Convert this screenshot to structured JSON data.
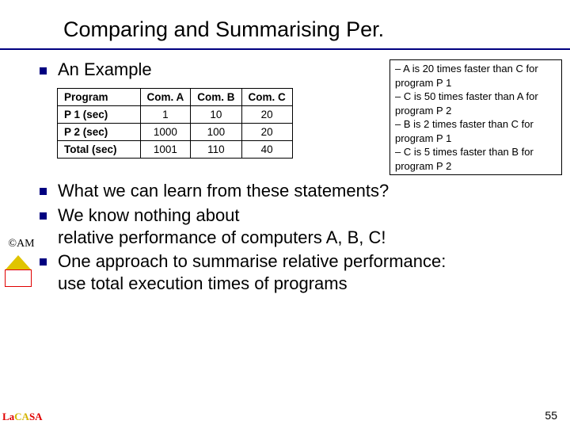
{
  "title": "Comparing and Summarising Per.",
  "heading": "An Example",
  "box": {
    "l1": "– A is 20 times faster than C for program P 1",
    "l2": "– C is 50 times faster than A for program P 2",
    "l3": "– B is 2 times faster than C for program P 1",
    "l4": "– C is 5 times faster than B for program P 2"
  },
  "table": {
    "h0": "Program",
    "h1": "Com. A",
    "h2": "Com. B",
    "h3": "Com. C",
    "r1": {
      "p": "P 1 (sec)",
      "a": "1",
      "b": "10",
      "c": "20"
    },
    "r2": {
      "p": "P 2 (sec)",
      "a": "1000",
      "b": "100",
      "c": "20"
    },
    "r3": {
      "p": "Total (sec)",
      "a": "1001",
      "b": "110",
      "c": "40"
    }
  },
  "bullets": {
    "b1": "What we can learn from these statements?",
    "b2a": "We know nothing about",
    "b2b": "relative performance of computers A, B, C!",
    "b3a": "One approach to summarise relative performance:",
    "b3b": "use total execution times of programs"
  },
  "am": "AM",
  "lacasa": {
    "p1": "La",
    "p2": "CA",
    "p3": "SA"
  },
  "pagenum": "55",
  "chart_data": {
    "type": "table",
    "title": "An Example",
    "columns": [
      "Program",
      "Com. A",
      "Com. B",
      "Com. C"
    ],
    "rows": [
      {
        "Program": "P 1 (sec)",
        "Com. A": 1,
        "Com. B": 10,
        "Com. C": 20
      },
      {
        "Program": "P 2 (sec)",
        "Com. A": 1000,
        "Com. B": 100,
        "Com. C": 20
      },
      {
        "Program": "Total (sec)",
        "Com. A": 1001,
        "Com. B": 110,
        "Com. C": 40
      }
    ]
  }
}
